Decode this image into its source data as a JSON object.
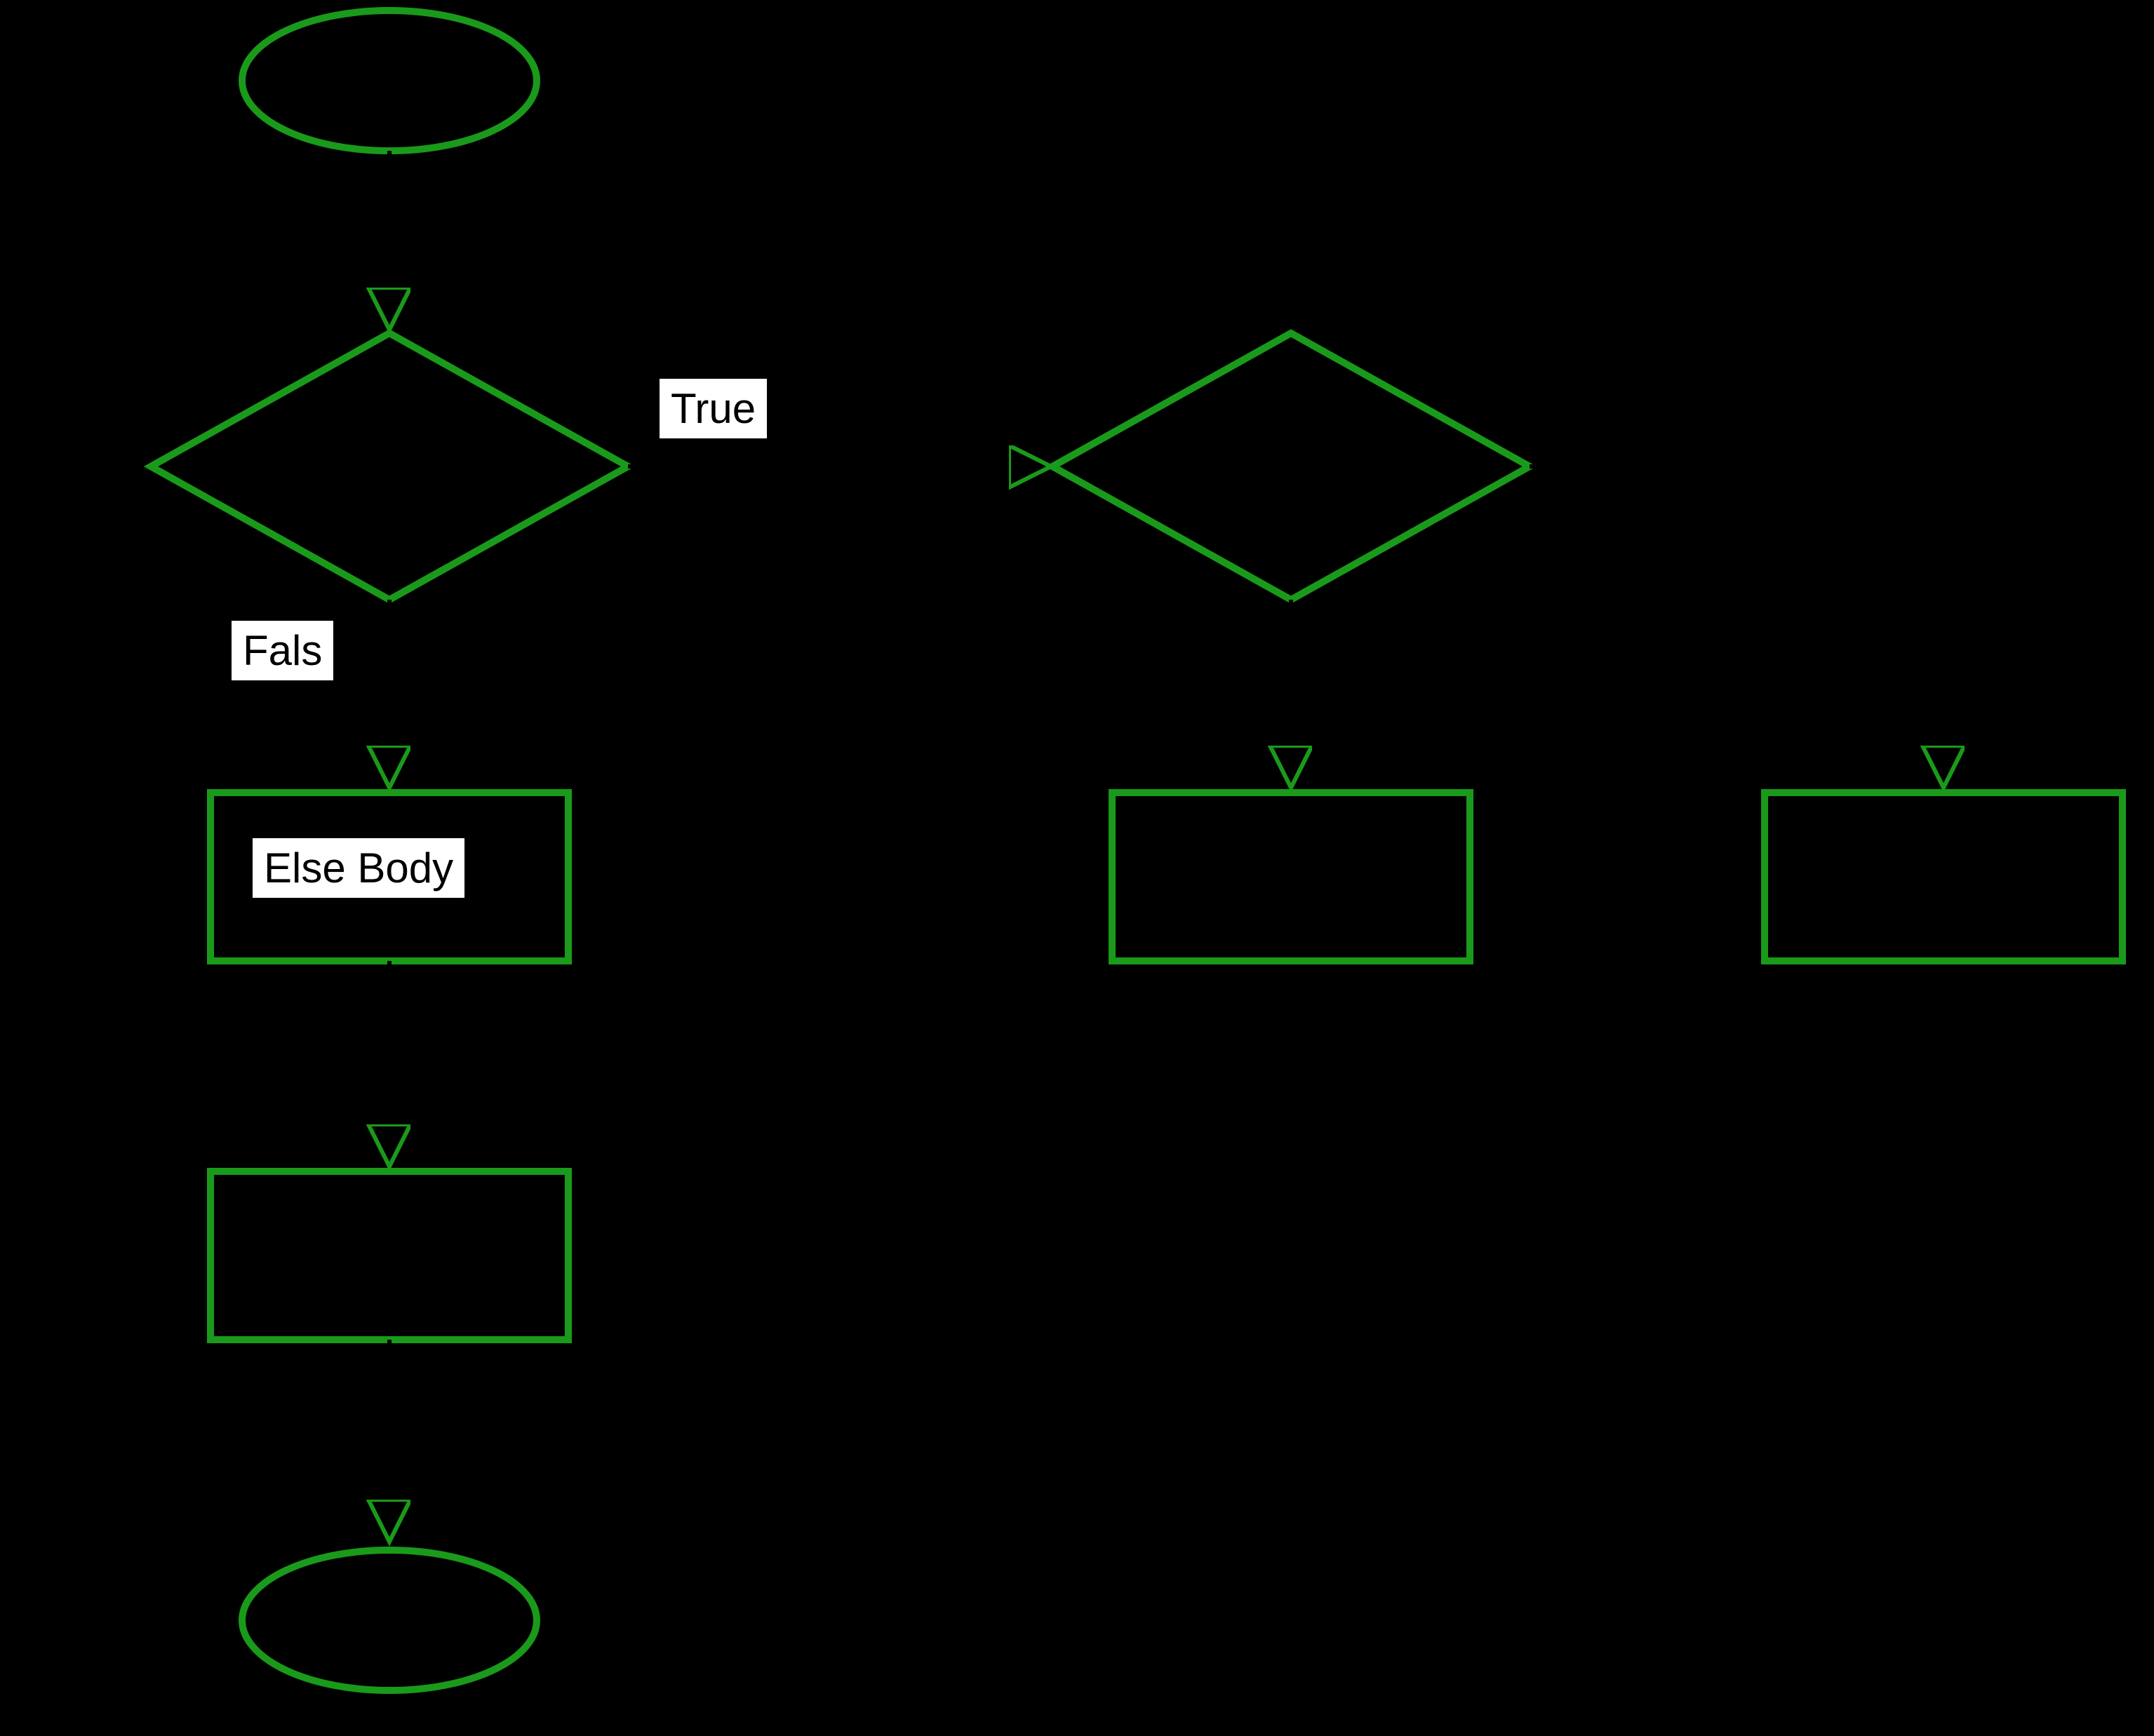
{
  "flowchart": {
    "nodes": {
      "start": {
        "type": "terminator",
        "shape": "ellipse"
      },
      "decision1": {
        "type": "decision",
        "shape": "diamond"
      },
      "decision2": {
        "type": "decision",
        "shape": "diamond"
      },
      "elseBody": {
        "type": "process",
        "shape": "rectangle",
        "label": "Else Body"
      },
      "process2": {
        "type": "process",
        "shape": "rectangle"
      },
      "process3": {
        "type": "process",
        "shape": "rectangle"
      },
      "process4": {
        "type": "process",
        "shape": "rectangle"
      },
      "end": {
        "type": "terminator",
        "shape": "ellipse"
      }
    },
    "edges": {
      "trueLabel": "True",
      "falseLabel": "Fals"
    },
    "colors": {
      "stroke": "#1a9a1a",
      "edgeStroke": "#000000",
      "background": "#000000",
      "labelBackground": "#ffffff"
    }
  }
}
